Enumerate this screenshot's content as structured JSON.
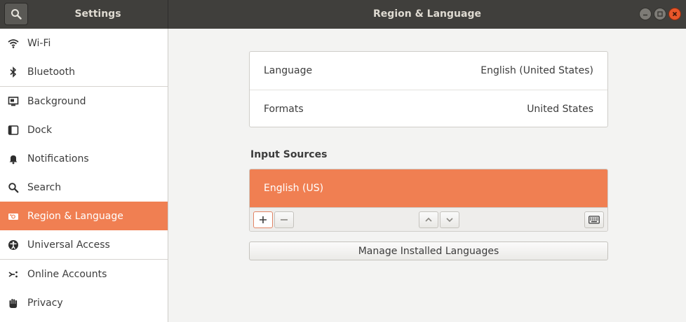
{
  "header": {
    "sidebar_title": "Settings",
    "window_title": "Region & Language"
  },
  "sidebar": {
    "items": [
      {
        "label": "Wi-Fi",
        "icon": "wifi-icon"
      },
      {
        "label": "Bluetooth",
        "icon": "bluetooth-icon"
      },
      {
        "label": "Background",
        "icon": "background-icon"
      },
      {
        "label": "Dock",
        "icon": "dock-icon"
      },
      {
        "label": "Notifications",
        "icon": "bell-icon"
      },
      {
        "label": "Search",
        "icon": "search-icon"
      },
      {
        "label": "Region & Language",
        "icon": "region-icon",
        "active": true
      },
      {
        "label": "Universal Access",
        "icon": "accessibility-icon"
      },
      {
        "label": "Online Accounts",
        "icon": "online-accounts-icon"
      },
      {
        "label": "Privacy",
        "icon": "hand-icon"
      }
    ]
  },
  "main": {
    "language": {
      "label": "Language",
      "value": "English (United States)"
    },
    "formats": {
      "label": "Formats",
      "value": "United States"
    },
    "input_sources_title": "Input Sources",
    "input_sources": [
      "English (US)"
    ],
    "manage_button": "Manage Installed Languages"
  },
  "colors": {
    "accent": "#f07f52",
    "headerbar": "#403f3c",
    "close_button": "#e9562a"
  }
}
